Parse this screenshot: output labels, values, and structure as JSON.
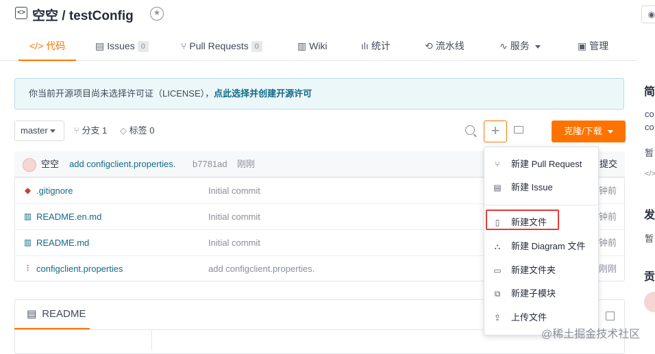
{
  "repo": {
    "title": "空空 / testConfig",
    "repo_icon": "code-icon",
    "badge_icon": "award-icon"
  },
  "tabs": [
    {
      "label": "代码",
      "icon": "code-icon",
      "active": true
    },
    {
      "label": "Issues",
      "count": "0",
      "icon": "issue-icon"
    },
    {
      "label": "Pull Requests",
      "count": "0",
      "icon": "pull-request-icon"
    },
    {
      "label": "Wiki",
      "icon": "book-icon"
    },
    {
      "label": "统计",
      "icon": "chart-icon"
    },
    {
      "label": "流水线",
      "icon": "pipeline-icon"
    },
    {
      "label": "服务",
      "icon": "pulse-icon"
    },
    {
      "label": "管理",
      "icon": "manage-icon"
    }
  ],
  "notice": {
    "text": "你当前开源项目尚未选择许可证（LICENSE），",
    "link": "点此选择并创建开源许可"
  },
  "toolbar": {
    "branch": "master",
    "branches": "分支 1",
    "tags": "标签 0",
    "clone_label": "克隆/下载"
  },
  "last_commit": {
    "author": "空空",
    "message": "add configclient.properties.",
    "hash": "b7781ad",
    "time": "刚刚",
    "right_label": "提交"
  },
  "files": [
    {
      "name": ".gitignore",
      "message": "Initial commit",
      "time": "钟前",
      "icon": "git-icon"
    },
    {
      "name": "README.en.md",
      "message": "Initial commit",
      "time": "钟前",
      "icon": "book-icon"
    },
    {
      "name": "README.md",
      "message": "Initial commit",
      "time": "钟前",
      "icon": "book-icon"
    },
    {
      "name": "configclient.properties",
      "message": "add configclient.properties.",
      "time": "刚刚",
      "icon": "settings-file-icon"
    }
  ],
  "readme": {
    "tab_label": "README"
  },
  "dropdown": {
    "items": [
      {
        "label": "新建 Pull Request",
        "icon": "pull-request-icon"
      },
      {
        "label": "新建 Issue",
        "icon": "issue-icon"
      },
      {
        "label": "新建文件",
        "icon": "file-icon"
      },
      {
        "label": "新建 Diagram 文件",
        "icon": "diagram-icon"
      },
      {
        "label": "新建文件夹",
        "icon": "folder-icon"
      },
      {
        "label": "新建子模块",
        "icon": "submodule-icon"
      },
      {
        "label": "上传文件",
        "icon": "upload-icon"
      }
    ]
  },
  "sidebar": {
    "h1": "简",
    "t1": "co",
    "t2": "co",
    "t3": "暂",
    "t4": "</>",
    "h2": "发",
    "t5": "暂",
    "h3": "贡"
  },
  "watermark": "@稀土掘金技术社区",
  "colors": {
    "accent": "#fe7300",
    "link": "#0f6b87",
    "highlight": "#e53935",
    "notice_bg": "#ecf7fa"
  }
}
